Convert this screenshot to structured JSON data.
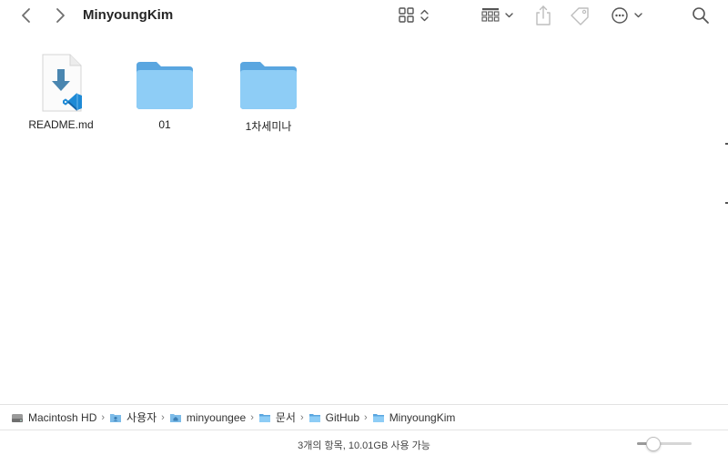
{
  "window": {
    "title": "MinyoungKim"
  },
  "toolbar": {
    "back_icon": "chevron-left-icon",
    "forward_icon": "chevron-right-icon",
    "view_icon": "icon-grid-view-icon",
    "group_icon": "group-by-icon",
    "share_icon": "share-icon",
    "tag_icon": "tag-icon",
    "action_icon": "more-actions-icon",
    "search_icon": "search-icon"
  },
  "files": [
    {
      "name": "README.md",
      "kind": "vscode-markdown-document"
    },
    {
      "name": "01",
      "kind": "folder"
    },
    {
      "name": "1차세미나",
      "kind": "folder"
    }
  ],
  "pathbar": {
    "items": [
      {
        "label": "Macintosh HD",
        "icon": "hard-drive-icon"
      },
      {
        "label": "사용자",
        "icon": "users-folder-icon"
      },
      {
        "label": "minyoungee",
        "icon": "home-folder-icon"
      },
      {
        "label": "문서",
        "icon": "folder-icon"
      },
      {
        "label": "GitHub",
        "icon": "folder-icon"
      },
      {
        "label": "MinyoungKim",
        "icon": "folder-icon"
      }
    ]
  },
  "status": {
    "text": "3개의 항목, 10.01GB 사용 가능"
  },
  "zoom": {
    "level": 0.3
  },
  "colors": {
    "folder_back": "#5aa6e0",
    "folder_front": "#8ecdf6",
    "vscode_blue": "#1e8ad6",
    "doc_arrow": "#4a86b0",
    "toolbar_icon": "#6e6e6e"
  }
}
